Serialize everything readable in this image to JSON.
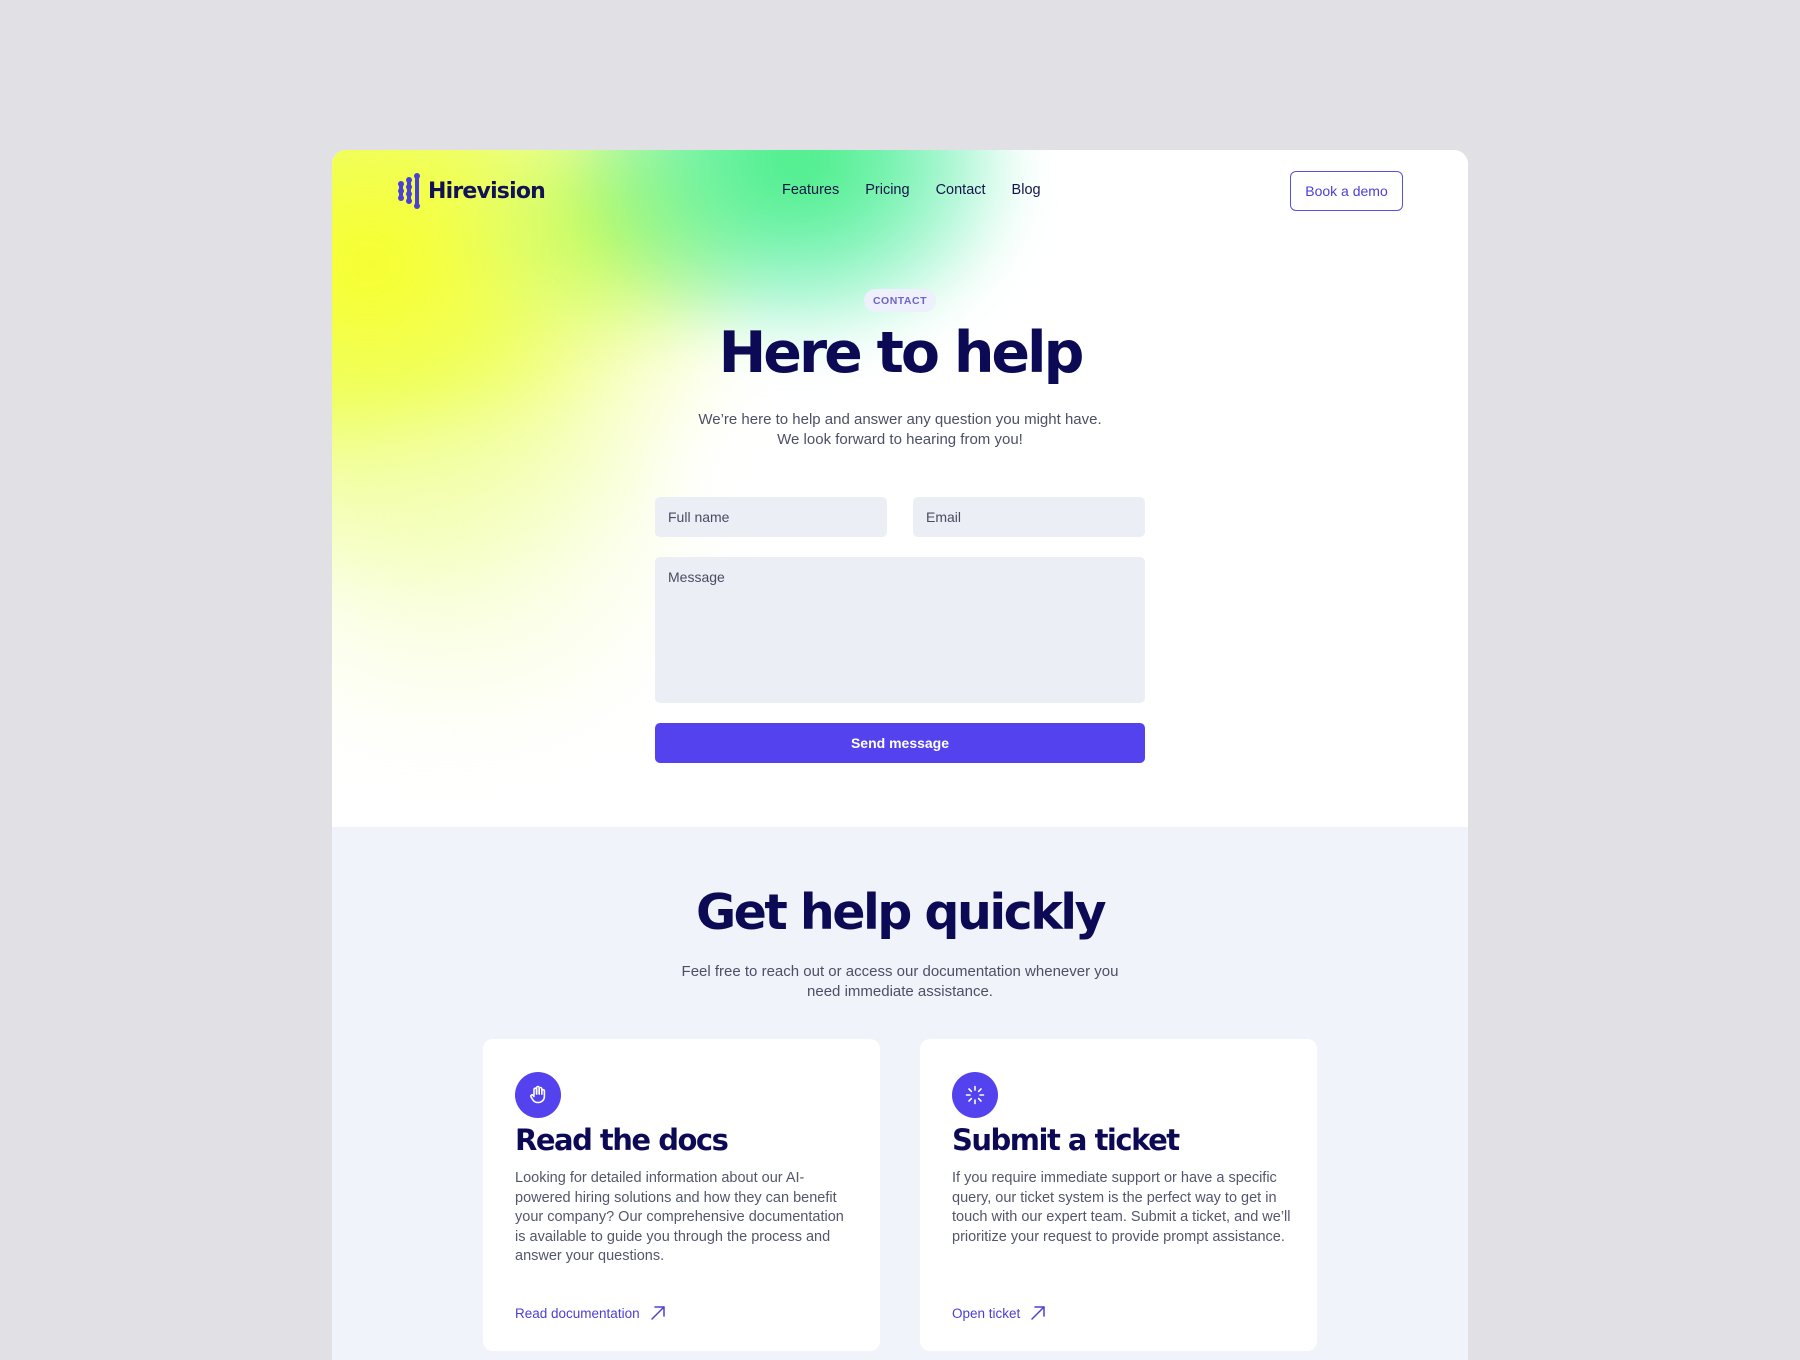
{
  "brand": {
    "name": "Hirevision",
    "accent": "#5442ee",
    "heading_color": "#0d0a55"
  },
  "nav": {
    "links": [
      "Features",
      "Pricing",
      "Contact",
      "Blog"
    ],
    "cta": "Book a demo"
  },
  "hero": {
    "badge": "CONTACT",
    "title": "Here to help",
    "subtitle_line1": "We’re here to help and answer any question you might have.",
    "subtitle_line2": "We look forward to hearing from you!"
  },
  "form": {
    "name_placeholder": "Full name",
    "email_placeholder": "Email",
    "message_placeholder": "Message",
    "submit": "Send message"
  },
  "help": {
    "title": "Get help quickly",
    "subtitle_line1": "Feel free to reach out or access our documentation whenever you",
    "subtitle_line2": "need immediate assistance.",
    "cards": [
      {
        "icon": "hand-icon",
        "title": "Read the docs",
        "body": "Looking for detailed information about our AI-powered hiring solutions and how they can benefit your company? Our comprehensive documentation is available to guide you through the process and answer your questions.",
        "link": "Read documentation"
      },
      {
        "icon": "loader-icon",
        "title": "Submit a ticket",
        "body": "If you require immediate support or have a specific query, our ticket system is the perfect way to get in touch with our expert team. Submit a ticket, and we’ll prioritize your request to provide prompt assistance.",
        "link": "Open ticket"
      }
    ]
  }
}
